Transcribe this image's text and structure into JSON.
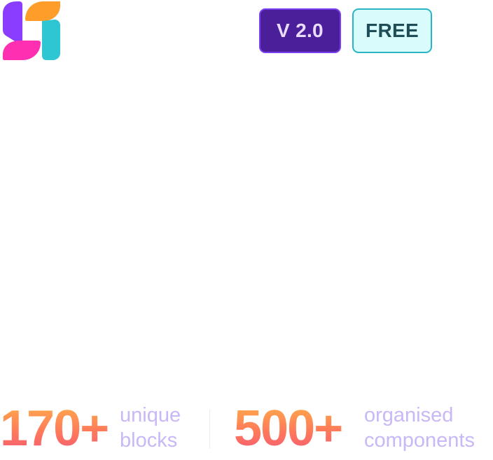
{
  "header": {
    "logo_icon": "brand-logo-icon",
    "version_badge": "V 2.0",
    "free_badge": "FREE"
  },
  "stats": [
    {
      "number": "170+",
      "label_line1": "unique",
      "label_line2": "blocks"
    },
    {
      "number": "500+",
      "label_line1": "organised",
      "label_line2": "components"
    }
  ],
  "colors": {
    "version_bg": "#4c1f9a",
    "version_border": "#7a3ff0",
    "free_bg": "#d9fbfb",
    "free_border": "#29b6c4",
    "stat_gradient_top": "#ffb347",
    "stat_gradient_bottom": "#f2557a",
    "stat_label": "#c9b8f7",
    "logo_purple": "#8b3dff",
    "logo_orange": "#ff9d2a",
    "logo_pink": "#ff2fb2",
    "logo_teal": "#2ec6d2"
  }
}
